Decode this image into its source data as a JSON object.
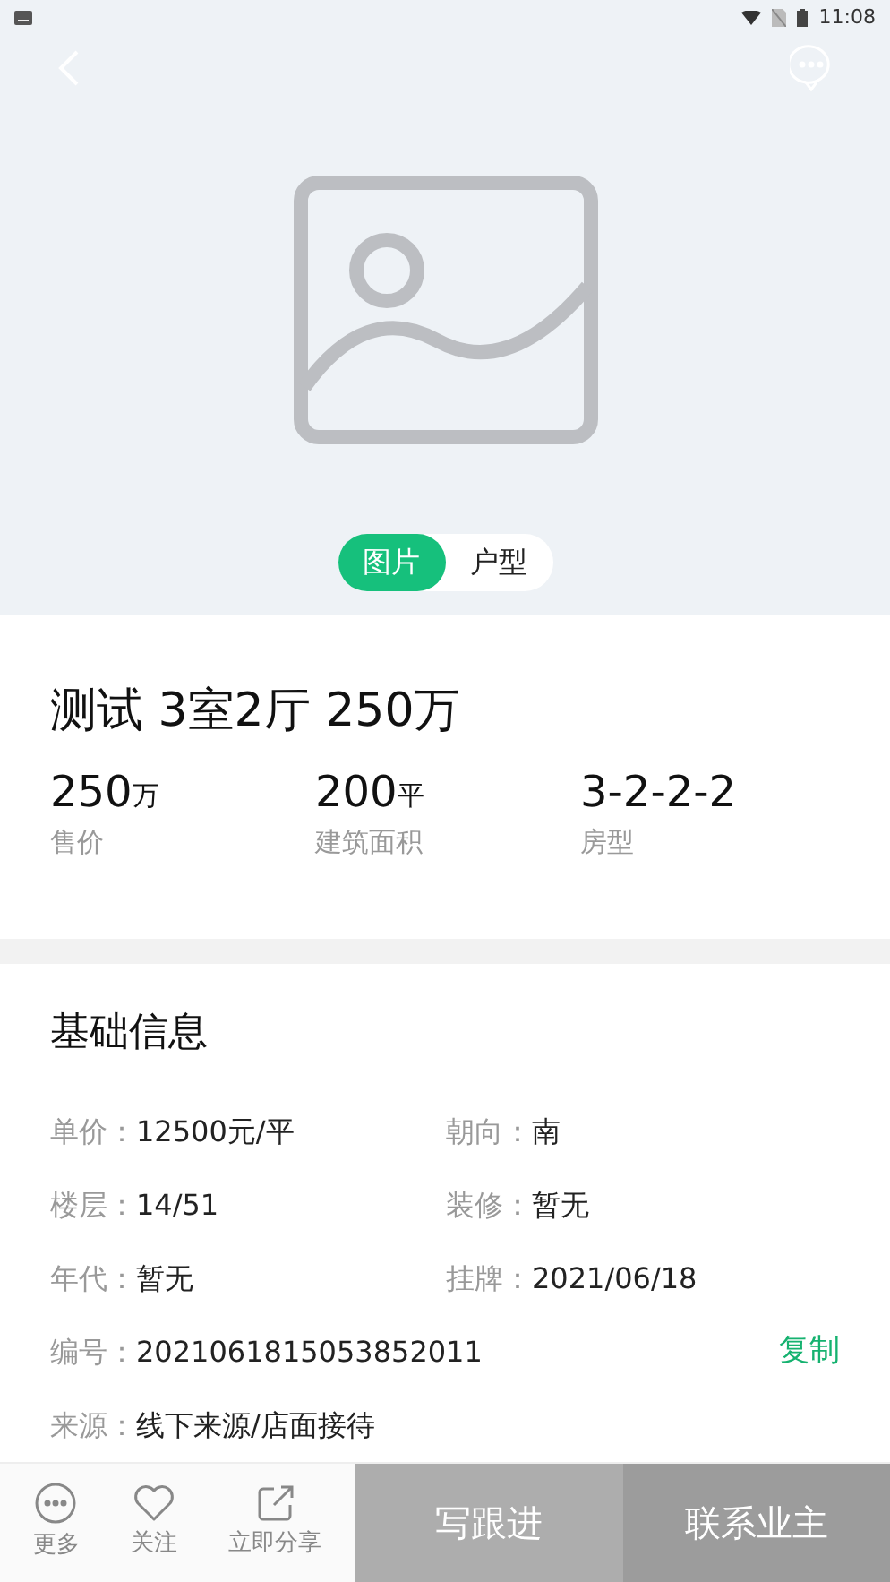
{
  "status_bar": {
    "time": "11:08"
  },
  "gallery": {
    "tabs": [
      {
        "label": "图片",
        "selected": true
      },
      {
        "label": "户型",
        "selected": false
      }
    ]
  },
  "listing": {
    "title": "测试 3室2厅 250万",
    "stats": [
      {
        "value": "250",
        "unit": "万",
        "label": "售价"
      },
      {
        "value": "200",
        "unit": "平",
        "label": "建筑面积"
      },
      {
        "value": "3-2-2-2",
        "label": "房型"
      }
    ]
  },
  "basic_info": {
    "heading": "基础信息",
    "rows": [
      [
        {
          "label": "单价：",
          "value": "12500元/平"
        },
        {
          "label": "朝向：",
          "value": "南"
        }
      ],
      [
        {
          "label": "楼层：",
          "value": "14/51"
        },
        {
          "label": "装修：",
          "value": "暂无"
        }
      ],
      [
        {
          "label": "年代：",
          "value": "暂无"
        },
        {
          "label": "挂牌：",
          "value": "2021/06/18"
        }
      ]
    ],
    "code": {
      "label": "编号：",
      "value": "2021061815053852011",
      "action": "复制"
    },
    "source": {
      "label": "来源：",
      "value": "线下来源/店面接待"
    }
  },
  "bottom_bar": {
    "actions": [
      {
        "kind": "more",
        "label": "更多"
      },
      {
        "kind": "follow",
        "label": "关注"
      },
      {
        "kind": "share",
        "label": "立即分享"
      }
    ],
    "buttons": [
      "写跟进",
      "联系业主"
    ]
  }
}
